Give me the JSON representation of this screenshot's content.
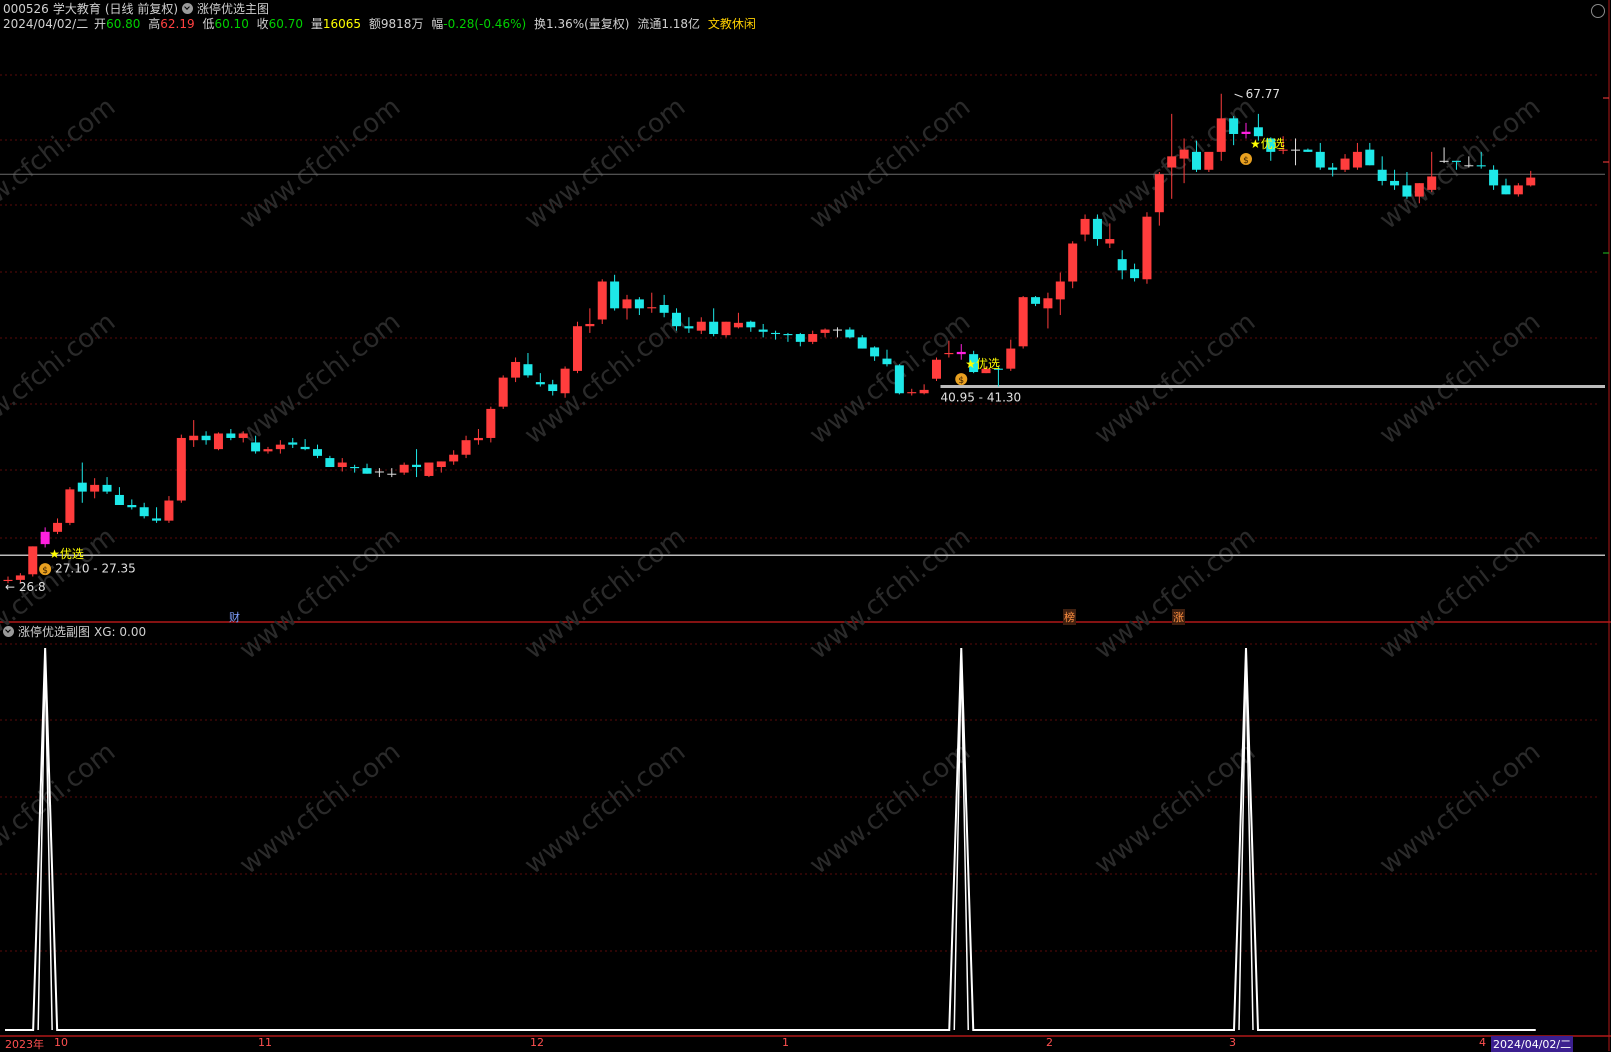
{
  "header": {
    "code": "000526",
    "name": "学大教育",
    "period": "(日线 前复权)",
    "main_indicator": "涨停优选主图",
    "date": "2024/04/02/二",
    "open_label": "开",
    "open": "60.80",
    "high_label": "高",
    "high": "62.19",
    "low_label": "低",
    "low": "60.10",
    "close_label": "收",
    "close": "60.70",
    "vol_label": "量",
    "volume": "16065",
    "amt_label": "额",
    "amount": "9818万",
    "chg_label": "幅",
    "change": "-0.28(-0.46%)",
    "turnover": "换1.36%(量复权)",
    "float": "流通1.18亿",
    "sector": "文教休闲"
  },
  "sub": {
    "indicator": "涨停优选副图",
    "xg_label": "XG: 0.00"
  },
  "annotations": {
    "high_mark": "67.77",
    "low_mark": "26.8",
    "range1": "27.10 - 27.35",
    "range2": "40.95 - 41.30",
    "pick": "★优选"
  },
  "badges": {
    "cai": "财",
    "bang": "榜",
    "zhang": "涨"
  },
  "xaxis": {
    "year": "2023年",
    "m10": "10",
    "m11": "11",
    "m12": "12",
    "m1": "1",
    "m2": "2",
    "m3": "3",
    "m4": "4",
    "current": "2024/04/02/二"
  },
  "watermark": "www.cfchi.com",
  "colors": {
    "up": "#ff3d3d",
    "down": "#1ee8e8",
    "pick": "#ff20e0",
    "accent": "#ffff00"
  },
  "chart_data": {
    "type": "candlestick",
    "period": "daily",
    "candles": [
      [
        24.2,
        24.6,
        24.0,
        24.3
      ],
      [
        24.3,
        24.9,
        24.0,
        24.7
      ],
      [
        24.8,
        27.3,
        24.6,
        27.3
      ],
      [
        27.5,
        29.0,
        27.2,
        28.6
      ],
      [
        28.6,
        29.8,
        28.4,
        29.4
      ],
      [
        29.4,
        32.6,
        29.2,
        32.4
      ],
      [
        33.0,
        34.8,
        31.2,
        32.2
      ],
      [
        32.2,
        33.4,
        31.6,
        32.8
      ],
      [
        32.8,
        33.5,
        32.0,
        32.2
      ],
      [
        31.9,
        32.6,
        31.0,
        31.0
      ],
      [
        31.0,
        31.5,
        30.6,
        30.8
      ],
      [
        30.8,
        31.2,
        29.8,
        30.0
      ],
      [
        29.8,
        30.8,
        29.4,
        29.6
      ],
      [
        29.6,
        31.8,
        29.4,
        31.4
      ],
      [
        31.4,
        37.3,
        31.2,
        37.0
      ],
      [
        36.8,
        38.6,
        36.2,
        37.2
      ],
      [
        37.2,
        37.6,
        36.4,
        36.8
      ],
      [
        36.0,
        37.5,
        35.9,
        37.4
      ],
      [
        37.4,
        37.8,
        36.8,
        37.0
      ],
      [
        37.0,
        37.6,
        36.6,
        37.4
      ],
      [
        36.6,
        37.2,
        35.6,
        35.8
      ],
      [
        35.8,
        36.2,
        35.6,
        36.0
      ],
      [
        36.0,
        36.8,
        35.6,
        36.4
      ],
      [
        36.6,
        37.0,
        36.1,
        36.4
      ],
      [
        36.2,
        36.9,
        35.9,
        36.0
      ],
      [
        36.0,
        36.4,
        35.2,
        35.4
      ],
      [
        35.2,
        35.4,
        34.4,
        34.4
      ],
      [
        34.4,
        35.2,
        34.0,
        34.8
      ],
      [
        34.4,
        34.6,
        33.9,
        34.3
      ],
      [
        34.3,
        34.7,
        33.8,
        33.8
      ],
      [
        34.0,
        34.3,
        33.5,
        34.0
      ],
      [
        33.8,
        34.3,
        33.5,
        33.8
      ],
      [
        33.9,
        34.8,
        33.7,
        34.6
      ],
      [
        34.6,
        36.0,
        33.5,
        34.4
      ],
      [
        33.6,
        34.8,
        33.5,
        34.8
      ],
      [
        34.4,
        34.9,
        33.9,
        34.9
      ],
      [
        34.9,
        35.9,
        34.6,
        35.5
      ],
      [
        35.5,
        37.2,
        35.2,
        36.8
      ],
      [
        36.8,
        37.8,
        36.4,
        37.0
      ],
      [
        37.0,
        39.8,
        36.6,
        39.6
      ],
      [
        39.8,
        42.6,
        39.6,
        42.4
      ],
      [
        42.4,
        44.2,
        42.0,
        43.8
      ],
      [
        43.6,
        44.6,
        42.4,
        42.6
      ],
      [
        42.0,
        42.8,
        41.6,
        41.8
      ],
      [
        41.8,
        42.2,
        40.8,
        41.2
      ],
      [
        41.0,
        43.4,
        40.6,
        43.2
      ],
      [
        43.0,
        47.4,
        42.8,
        47.0
      ],
      [
        47.0,
        48.6,
        46.4,
        47.2
      ],
      [
        47.6,
        51.2,
        47.2,
        51.0
      ],
      [
        51.0,
        51.6,
        48.4,
        48.6
      ],
      [
        48.6,
        49.8,
        47.6,
        49.4
      ],
      [
        49.4,
        49.6,
        48.0,
        48.6
      ],
      [
        48.6,
        50.0,
        48.2,
        48.7
      ],
      [
        48.9,
        49.8,
        47.8,
        48.2
      ],
      [
        48.2,
        48.6,
        46.6,
        47.0
      ],
      [
        47.0,
        47.8,
        46.4,
        46.8
      ],
      [
        46.6,
        47.8,
        46.3,
        47.4
      ],
      [
        47.4,
        48.6,
        46.1,
        46.3
      ],
      [
        46.2,
        47.4,
        46.0,
        47.4
      ],
      [
        46.9,
        48.2,
        46.8,
        47.3
      ],
      [
        47.4,
        47.5,
        46.5,
        46.9
      ],
      [
        46.7,
        47.2,
        46.0,
        46.5
      ],
      [
        46.4,
        46.6,
        45.8,
        46.3
      ],
      [
        46.3,
        46.4,
        45.6,
        46.2
      ],
      [
        46.3,
        46.4,
        45.2,
        45.6
      ],
      [
        45.6,
        46.6,
        45.4,
        46.3
      ],
      [
        46.4,
        46.8,
        46.0,
        46.7
      ],
      [
        46.7,
        46.9,
        46.0,
        46.7
      ],
      [
        46.7,
        46.9,
        45.9,
        46.0
      ],
      [
        46.0,
        46.2,
        45.0,
        45.0
      ],
      [
        45.1,
        45.2,
        43.9,
        44.3
      ],
      [
        44.1,
        44.9,
        43.4,
        43.6
      ],
      [
        43.5,
        43.6,
        40.9,
        41.0
      ],
      [
        41.0,
        41.4,
        40.8,
        41.1
      ],
      [
        41.0,
        41.8,
        40.9,
        41.3
      ],
      [
        42.3,
        44.2,
        42.1,
        44.0
      ],
      [
        44.5,
        45.7,
        44.2,
        44.6
      ],
      [
        44.7,
        45.4,
        44.0,
        44.5
      ],
      [
        44.5,
        44.8,
        42.8,
        42.9
      ],
      [
        42.8,
        43.4,
        42.8,
        43.2
      ],
      [
        43.2,
        43.4,
        41.6,
        43.1
      ],
      [
        43.2,
        45.8,
        43.0,
        45.0
      ],
      [
        45.2,
        49.7,
        45.0,
        49.6
      ],
      [
        49.6,
        49.7,
        48.8,
        49.0
      ],
      [
        48.6,
        50.0,
        46.8,
        49.5
      ],
      [
        49.4,
        51.8,
        48.0,
        51.0
      ],
      [
        51.0,
        54.6,
        50.4,
        54.4
      ],
      [
        55.2,
        57.0,
        54.6,
        56.6
      ],
      [
        56.6,
        57.0,
        54.2,
        54.8
      ],
      [
        54.4,
        56.2,
        54.0,
        54.8
      ],
      [
        53.0,
        53.8,
        51.2,
        52.0
      ],
      [
        52.1,
        52.6,
        51.0,
        51.3
      ],
      [
        51.2,
        57.2,
        50.8,
        56.8
      ],
      [
        57.2,
        60.8,
        56.0,
        60.6
      ],
      [
        61.2,
        66.0,
        58.4,
        62.2
      ],
      [
        62.0,
        63.8,
        59.8,
        62.8
      ],
      [
        62.6,
        63.6,
        60.8,
        61.0
      ],
      [
        61.0,
        62.4,
        60.8,
        62.6
      ],
      [
        62.6,
        67.8,
        61.8,
        65.6
      ],
      [
        65.6,
        65.8,
        63.2,
        64.2
      ],
      [
        64.2,
        65.2,
        63.8,
        64.4
      ],
      [
        64.8,
        66.0,
        63.6,
        64.0
      ],
      [
        63.8,
        63.9,
        61.8,
        62.6
      ],
      [
        62.7,
        64.0,
        62.4,
        62.8
      ],
      [
        62.8,
        63.8,
        61.4,
        62.8
      ],
      [
        62.8,
        62.9,
        62.6,
        62.6
      ],
      [
        62.6,
        63.4,
        61.0,
        61.2
      ],
      [
        61.2,
        61.6,
        60.4,
        61.0
      ],
      [
        61.0,
        62.4,
        60.8,
        62.0
      ],
      [
        61.2,
        63.4,
        61.0,
        62.6
      ],
      [
        62.8,
        63.4,
        61.4,
        61.4
      ],
      [
        61.0,
        62.2,
        59.6,
        60.0
      ],
      [
        60.0,
        61.0,
        59.2,
        59.6
      ],
      [
        59.6,
        60.8,
        58.4,
        58.6
      ],
      [
        58.6,
        59.8,
        58.0,
        59.8
      ],
      [
        59.2,
        62.6,
        59.0,
        60.4
      ],
      [
        61.8,
        63.0,
        61.6,
        61.8
      ],
      [
        61.8,
        61.8,
        61.0,
        61.7
      ],
      [
        61.4,
        62.2,
        61.2,
        61.4
      ],
      [
        61.4,
        62.6,
        61.1,
        61.3
      ],
      [
        61.0,
        61.4,
        59.2,
        59.6
      ],
      [
        59.6,
        60.2,
        58.8,
        58.8
      ],
      [
        58.8,
        59.8,
        58.6,
        59.6
      ],
      [
        59.6,
        60.9,
        59.5,
        60.3
      ]
    ],
    "limit_up_days": [
      3,
      77,
      100
    ],
    "hlines": [
      26.5,
      41.6,
      60.6
    ],
    "annotations": [
      {
        "label": "67.77",
        "i": 99,
        "price": 67.77
      },
      {
        "label": "26.8",
        "i": 0,
        "price": 24.2
      },
      {
        "label": "27.10 - 27.35",
        "i": 3,
        "price": 27.2
      },
      {
        "label": "40.95 - 41.30",
        "i": 74,
        "price": 41.1
      }
    ],
    "sub_series": {
      "name": "XG",
      "values": "pulses of 1 at limit_up_days, 0 elsewhere",
      "ylim": [
        0,
        1
      ]
    },
    "ylim": [
      22.5,
      71.0
    ]
  }
}
